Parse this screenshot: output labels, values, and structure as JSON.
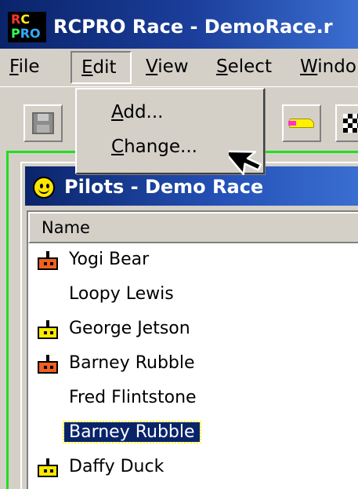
{
  "app": {
    "logo_line1": [
      "R",
      "C"
    ],
    "logo_line2": [
      "P",
      "RO"
    ],
    "title": "RCPRO Race - DemoRace.r"
  },
  "menubar": {
    "file": {
      "ul": "F",
      "rest": "ile"
    },
    "edit": {
      "ul": "E",
      "rest": "dit"
    },
    "view": {
      "ul": "V",
      "rest": "iew"
    },
    "select": {
      "ul": "S",
      "rest": "elect"
    },
    "window": {
      "ul": "W",
      "rest": "indo"
    }
  },
  "edit_menu": {
    "add": {
      "ul": "A",
      "rest": "dd..."
    },
    "change": {
      "ul": "C",
      "rest": "hange..."
    }
  },
  "child_window": {
    "title": "Pilots - Demo Race"
  },
  "list": {
    "column_header": "Name",
    "rows": [
      {
        "name": "Yogi Bear",
        "icon": "radio-transmitter-orange-icon"
      },
      {
        "name": "Loopy Lewis",
        "icon": ""
      },
      {
        "name": "George Jetson",
        "icon": "radio-transmitter-yellow-icon"
      },
      {
        "name": "Barney Rubble",
        "icon": "radio-transmitter-orange-icon"
      },
      {
        "name": "Fred Flintstone",
        "icon": ""
      },
      {
        "name": "Barney Rubble",
        "icon": "",
        "selected": true
      },
      {
        "name": "Daffy Duck",
        "icon": "radio-transmitter-yellow-icon"
      }
    ]
  },
  "colors": {
    "titlebar": "#0a246a",
    "frame_accent": "#22dd22",
    "selection": "#0a246a",
    "transmitter_orange": "#f06020",
    "transmitter_yellow": "#ffe800"
  }
}
